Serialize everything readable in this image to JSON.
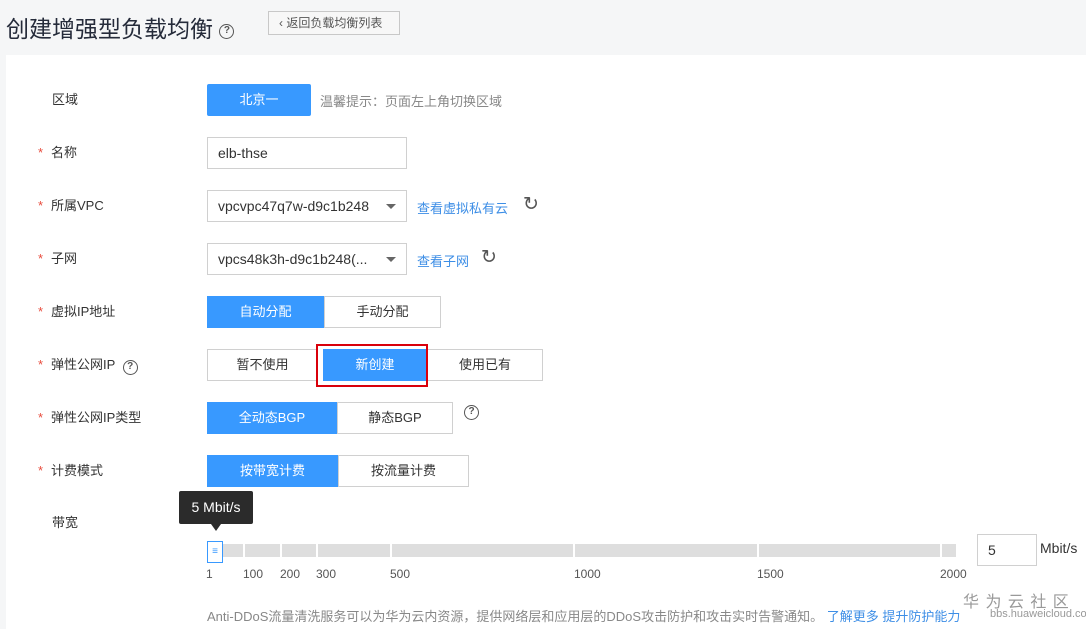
{
  "header": {
    "title": "创建增强型负载均衡",
    "help_icon": "question-circle-icon",
    "back_label": "返回负载均衡列表"
  },
  "form": {
    "region": {
      "label": "区域",
      "value": "北京一",
      "hint": "温馨提示：页面左上角切换区域"
    },
    "name": {
      "label": "名称",
      "value": "elb-thse"
    },
    "vpc": {
      "label": "所属VPC",
      "value": "vpcvpc47q7w-d9c1b248",
      "link": "查看虚拟私有云"
    },
    "subnet": {
      "label": "子网",
      "value": "vpcs48k3h-d9c1b248(...",
      "link": "查看子网"
    },
    "vip": {
      "label": "虚拟IP地址",
      "options": [
        "自动分配",
        "手动分配"
      ],
      "selected": 0
    },
    "eip": {
      "label": "弹性公网IP",
      "options": [
        "暂不使用",
        "新创建",
        "使用已有"
      ],
      "selected": 1
    },
    "eip_type": {
      "label": "弹性公网IP类型",
      "options": [
        "全动态BGP",
        "静态BGP"
      ],
      "selected": 0
    },
    "billing": {
      "label": "计费模式",
      "options": [
        "按带宽计费",
        "按流量计费"
      ],
      "selected": 0
    },
    "bandwidth": {
      "label": "带宽",
      "tooltip": "5 Mbit/s",
      "value": "5",
      "unit": "Mbit/s",
      "min": 1,
      "max": 2000,
      "current": 5,
      "ticks": [
        "1",
        "100",
        "200",
        "300",
        "500",
        "1000",
        "1500",
        "2000"
      ]
    }
  },
  "footer": {
    "text": "Anti-DDoS流量清洗服务可以为华为云内资源，提供网络层和应用层的DDoS攻击防护和攻击实时告警通知。",
    "link1": "了解更多",
    "link2": "提升防护能力"
  },
  "watermark": {
    "title": "华 为 云 社 区",
    "url": "bbs.huaweicloud.com"
  },
  "colors": {
    "primary": "#3899ff",
    "required": "#e84c3d",
    "link": "#3d8ee6",
    "highlight": "#d9000b"
  }
}
